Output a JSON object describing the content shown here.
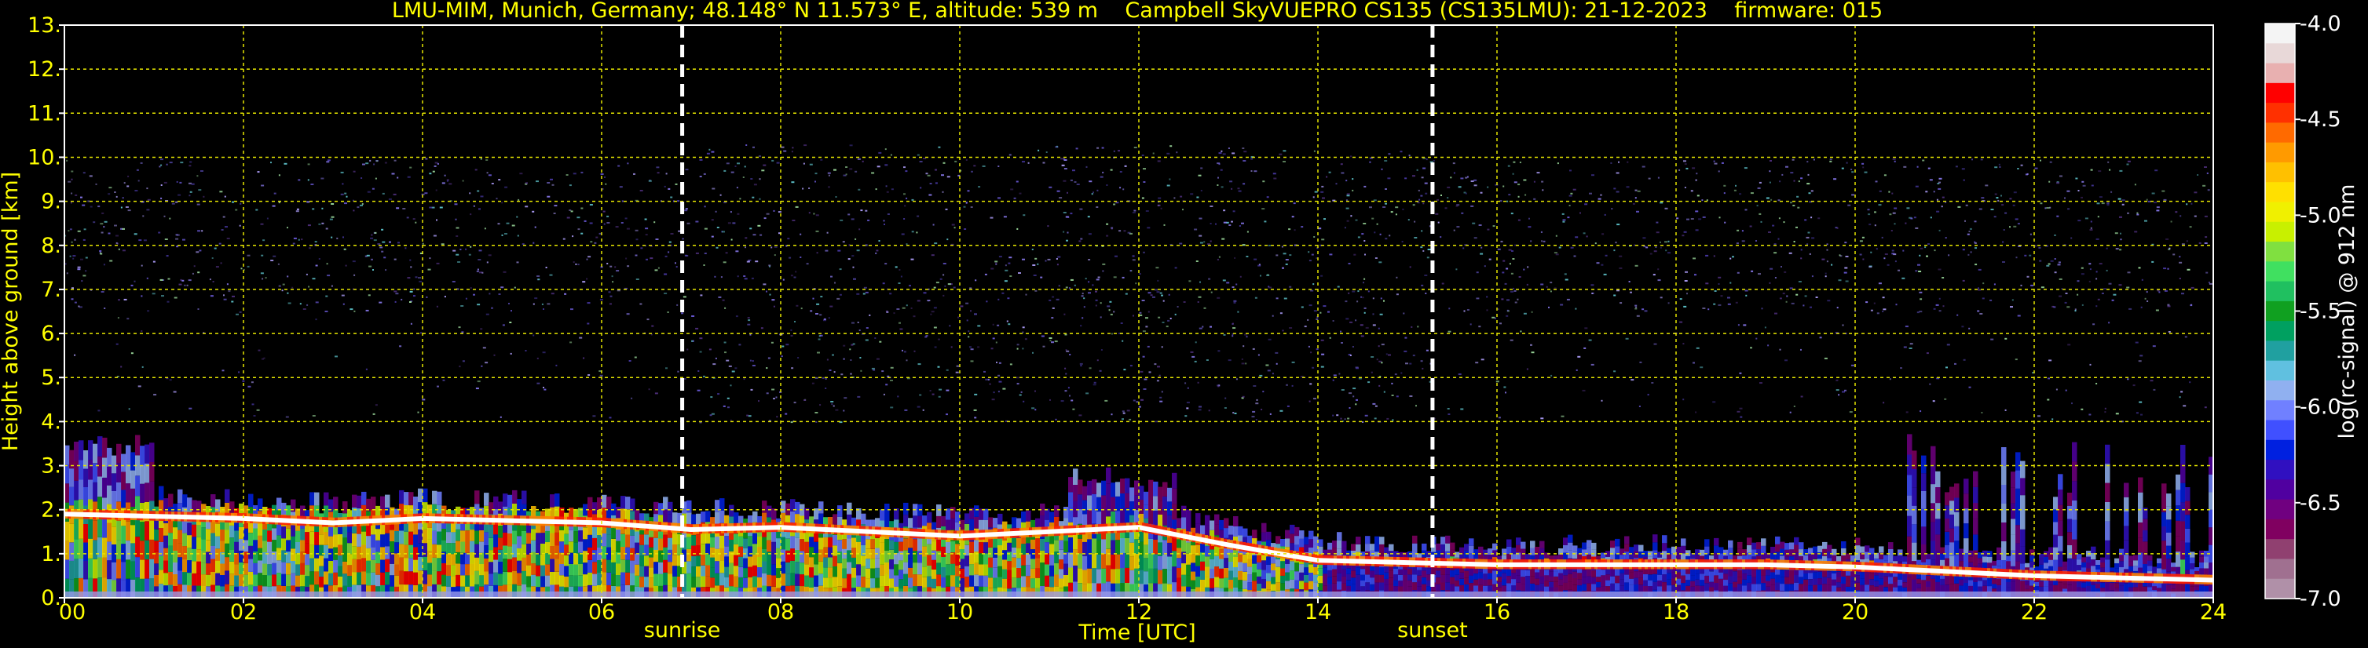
{
  "chart_data": {
    "type": "heatmap",
    "title": "LMU-MIM, Munich, Germany; 48.148° N 11.573° E, altitude: 539 m    Campbell SkyVUEPRO CS135 (CS135LMU): 21-12-2023    firmware: 015",
    "xlabel": "Time [UTC]",
    "ylabel": "Height above ground [km]",
    "x_ticks": [
      "00",
      "02",
      "04",
      "06",
      "08",
      "10",
      "12",
      "14",
      "16",
      "18",
      "20",
      "22",
      "24"
    ],
    "y_ticks": [
      "0.",
      "1.",
      "2.",
      "3.",
      "4.",
      "5.",
      "6.",
      "7.",
      "8.",
      "9.",
      "10.",
      "11.",
      "12.",
      "13."
    ],
    "xlim": [
      0,
      24
    ],
    "ylim": [
      0,
      13
    ],
    "grid": true,
    "annotations": [
      {
        "label": "sunrise",
        "x": 6.9
      },
      {
        "label": "sunset",
        "x": 15.28
      }
    ],
    "colorbar": {
      "label": "log(rc-signal) @ 912 nm",
      "ticks": [
        "-4.0",
        "-4.5",
        "-5.0",
        "-5.5",
        "-6.0",
        "-6.5",
        "-7.0"
      ],
      "range": [
        -7.0,
        -4.0
      ],
      "colors": [
        "#f4f4f4",
        "#e8d8d8",
        "#e8b0b0",
        "#ff0000",
        "#ff3000",
        "#ff6a00",
        "#ff9a00",
        "#ffc000",
        "#ffe000",
        "#f0f000",
        "#c8f000",
        "#80e040",
        "#40e060",
        "#20c060",
        "#10a020",
        "#00a060",
        "#20a0a0",
        "#60c0e0",
        "#90b0f0",
        "#7080ff",
        "#4050ff",
        "#0020e0",
        "#3010c0",
        "#5000a0",
        "#700080",
        "#800060",
        "#904070",
        "#a07090",
        "#b090a8"
      ]
    },
    "cloud_base_km": [
      {
        "time": 0.0,
        "height": 1.9
      },
      {
        "time": 1.0,
        "height": 1.85
      },
      {
        "time": 2.0,
        "height": 1.8
      },
      {
        "time": 3.0,
        "height": 1.7
      },
      {
        "time": 4.0,
        "height": 1.8
      },
      {
        "time": 5.0,
        "height": 1.75
      },
      {
        "time": 6.0,
        "height": 1.7
      },
      {
        "time": 7.0,
        "height": 1.55
      },
      {
        "time": 8.0,
        "height": 1.6
      },
      {
        "time": 9.0,
        "height": 1.5
      },
      {
        "time": 10.0,
        "height": 1.4
      },
      {
        "time": 11.0,
        "height": 1.5
      },
      {
        "time": 12.0,
        "height": 1.6
      },
      {
        "time": 13.0,
        "height": 1.2
      },
      {
        "time": 14.0,
        "height": 0.85
      },
      {
        "time": 15.0,
        "height": 0.8
      },
      {
        "time": 16.0,
        "height": 0.75
      },
      {
        "time": 17.0,
        "height": 0.75
      },
      {
        "time": 18.0,
        "height": 0.75
      },
      {
        "time": 19.0,
        "height": 0.75
      },
      {
        "time": 20.0,
        "height": 0.7
      },
      {
        "time": 21.0,
        "height": 0.6
      },
      {
        "time": 22.0,
        "height": 0.5
      },
      {
        "time": 23.0,
        "height": 0.45
      },
      {
        "time": 24.0,
        "height": 0.4
      }
    ],
    "noise_top_km": 10.3
  }
}
